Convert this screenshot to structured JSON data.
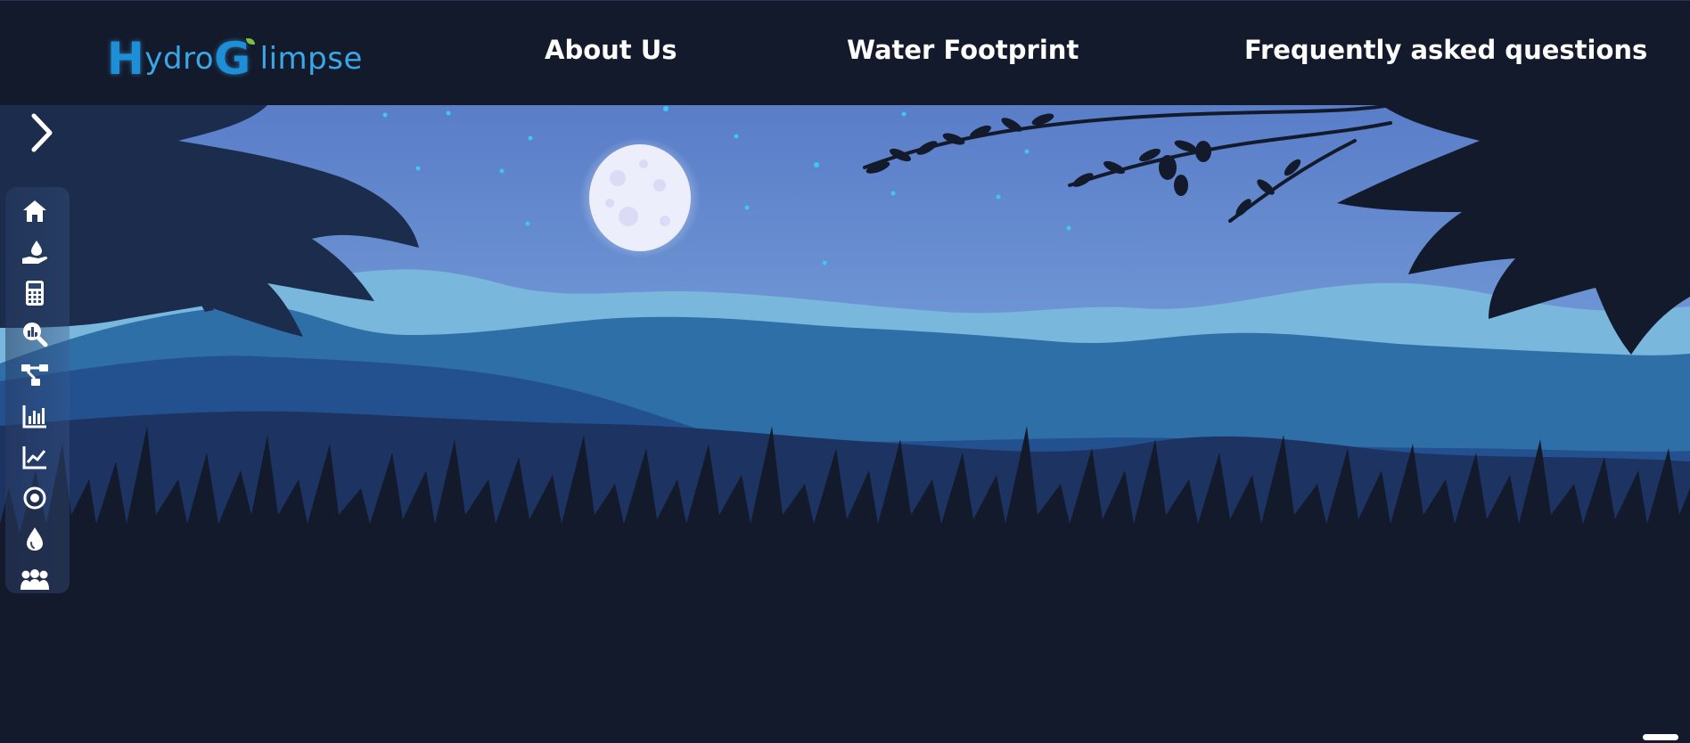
{
  "brand": {
    "logo_first": "H",
    "logo_mid": "ydro",
    "logo_g": "G",
    "logo_end": "limpse"
  },
  "nav": {
    "items": [
      {
        "label": "About Us"
      },
      {
        "label": "Water Footprint"
      },
      {
        "label": "Frequently asked questions"
      }
    ]
  },
  "sidebar": {
    "toggle_icon": "chevron-right-icon",
    "items": [
      {
        "icon": "home-icon"
      },
      {
        "icon": "hand-water-drop-icon"
      },
      {
        "icon": "calculator-icon"
      },
      {
        "icon": "search-chart-icon"
      },
      {
        "icon": "flow-diagram-icon"
      },
      {
        "icon": "bar-chart-icon"
      },
      {
        "icon": "line-chart-icon"
      },
      {
        "icon": "target-icon"
      },
      {
        "icon": "water-drop-icon"
      },
      {
        "icon": "group-icon"
      }
    ]
  },
  "colors": {
    "nav_bg": "#131a2c",
    "sky_top": "#5b7fc9",
    "sky_bottom": "#8ab8e4",
    "moon": "#eef0fb",
    "foreground": "#131a2c",
    "accent": "#2fa6e6"
  }
}
